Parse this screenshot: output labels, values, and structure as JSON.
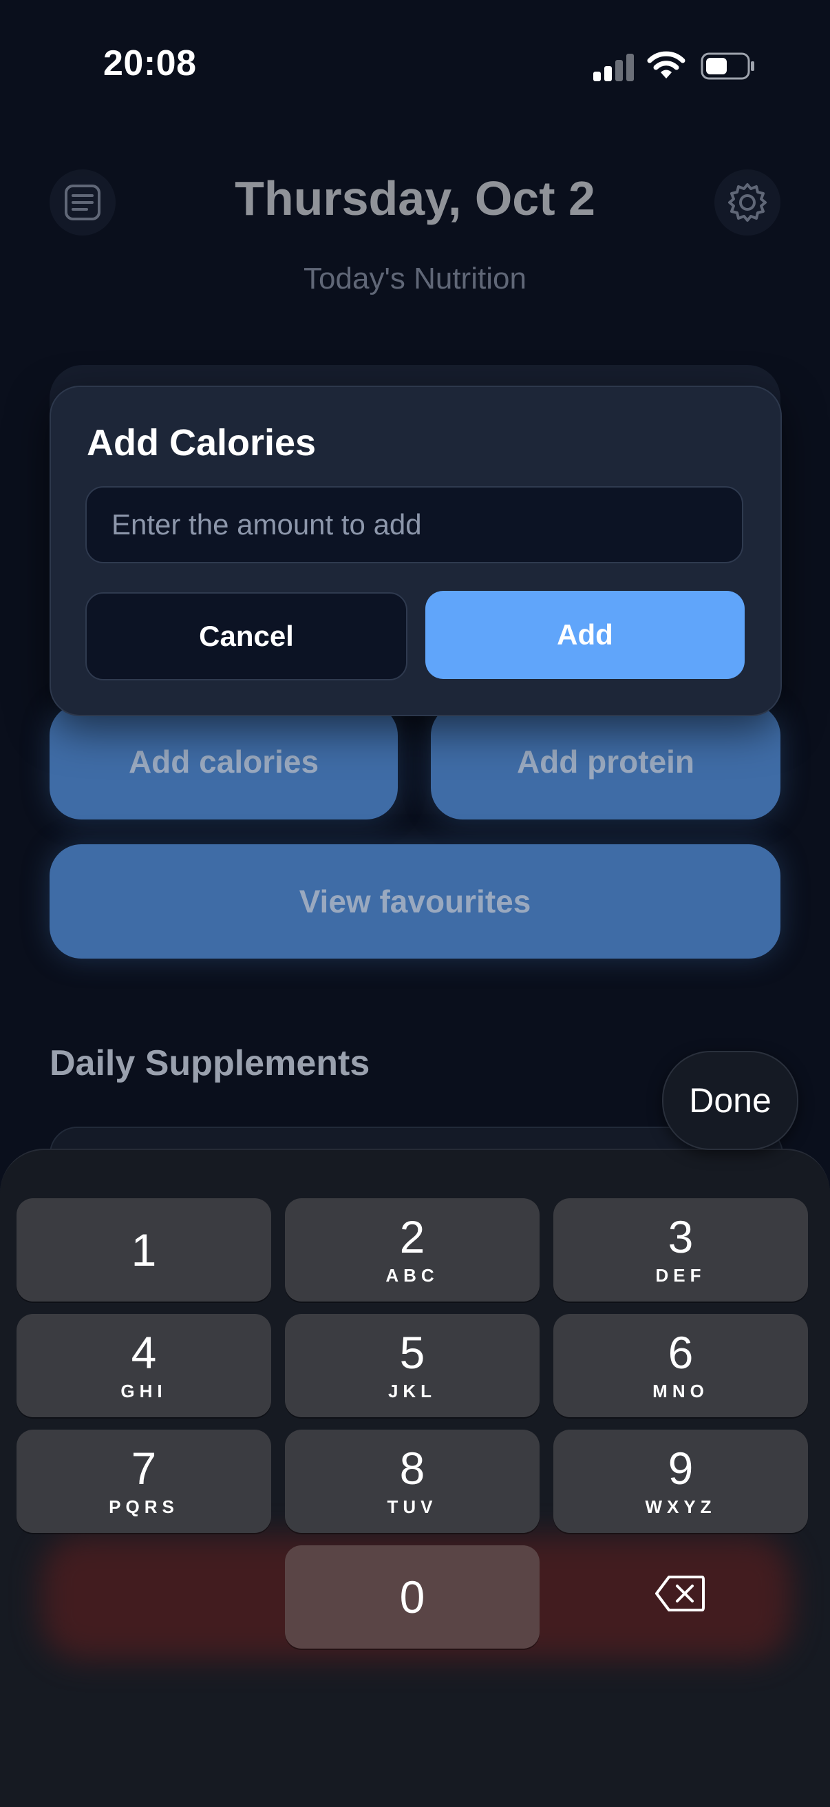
{
  "status_bar": {
    "time": "20:08",
    "icons": [
      "cellular-signal-icon",
      "wifi-icon",
      "battery-icon"
    ]
  },
  "header": {
    "left_icon": "notes-list-icon",
    "title": "Thursday, Oct 2",
    "subtitle": "Today's Nutrition",
    "right_icon": "gear-icon"
  },
  "dialog": {
    "title": "Add Calories",
    "input_value": "",
    "input_placeholder": "Enter the amount to add",
    "cancel_label": "Cancel",
    "add_label": "Add"
  },
  "actions": {
    "add_calories_label": "Add calories",
    "add_protein_label": "Add protein",
    "view_favourites_label": "View favourites"
  },
  "supplements": {
    "section_title": "Daily Supplements"
  },
  "keyboard": {
    "done_label": "Done",
    "keys": [
      {
        "num": "1",
        "letters": ""
      },
      {
        "num": "2",
        "letters": "ABC"
      },
      {
        "num": "3",
        "letters": "DEF"
      },
      {
        "num": "4",
        "letters": "GHI"
      },
      {
        "num": "5",
        "letters": "JKL"
      },
      {
        "num": "6",
        "letters": "MNO"
      },
      {
        "num": "7",
        "letters": "PQRS"
      },
      {
        "num": "8",
        "letters": "TUV"
      },
      {
        "num": "9",
        "letters": "WXYZ"
      },
      {
        "num": "0",
        "letters": ""
      }
    ],
    "backspace_icon": "backspace-icon"
  },
  "colors": {
    "background": "#0a0f1c",
    "dialog": "#1d2638",
    "accent": "#60a5fa",
    "dimmed_button": "#3f6ca6",
    "key": "#3b3c41"
  }
}
